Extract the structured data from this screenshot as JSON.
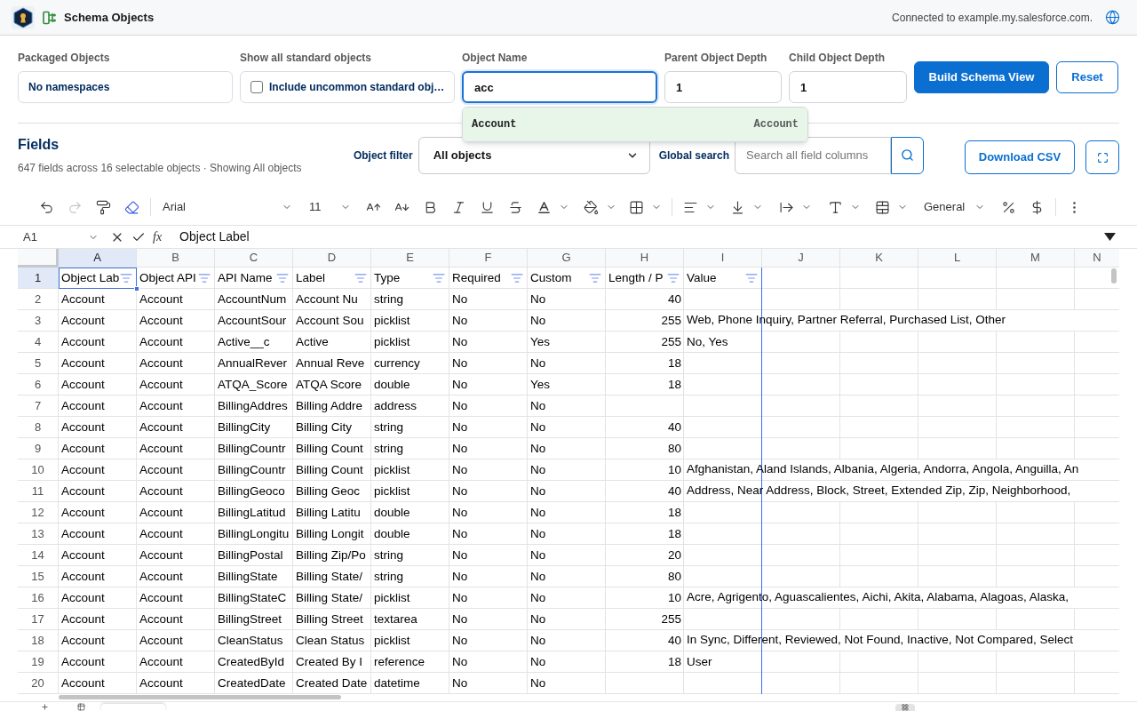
{
  "header": {
    "title": "Schema Objects",
    "connection": "Connected to example.my.salesforce.com."
  },
  "filters": {
    "packaged_objects": {
      "label": "Packaged Objects",
      "value": "No namespaces"
    },
    "standard_objects": {
      "label": "Show all standard objects",
      "option": "Include uncommon standard obj…",
      "checked": false
    },
    "object_name": {
      "label": "Object Name",
      "value": "acc",
      "focused": true,
      "suggestions": [
        {
          "label": "Account",
          "api_name": "Account",
          "selected": true
        }
      ]
    },
    "parent_depth": {
      "label": "Parent Object Depth",
      "value": "1"
    },
    "child_depth": {
      "label": "Child Object Depth",
      "value": "1"
    },
    "buttons": [
      {
        "label": "Build Schema View",
        "kind": "primary"
      },
      {
        "label": "Reset",
        "kind": "secondary"
      }
    ]
  },
  "fields": {
    "title": "Fields",
    "summary": "647 fields across 16 selectable objects · Showing All objects",
    "object_filter": {
      "label": "Object filter",
      "value": "All objects"
    },
    "global_search": {
      "label": "Global search",
      "placeholder": "Search all field columns"
    },
    "download_button": "Download CSV"
  },
  "toolbar": {
    "history": [
      {
        "kind": "undo",
        "disabled": false
      },
      {
        "kind": "redo",
        "disabled": true
      }
    ],
    "font": "Arial",
    "font_size": "11",
    "number_format": "General"
  },
  "formula_bar": {
    "cell_ref": "A1",
    "function_label": "fx",
    "value": "Object Label"
  },
  "sheet": {
    "columns": [
      {
        "label": "A",
        "selected": true
      },
      {
        "label": "B",
        "selected": false
      },
      {
        "label": "C",
        "selected": false
      },
      {
        "label": "D",
        "selected": false
      },
      {
        "label": "E",
        "selected": false
      },
      {
        "label": "F",
        "selected": false
      },
      {
        "label": "G",
        "selected": false
      },
      {
        "label": "H",
        "selected": false
      },
      {
        "label": "I",
        "selected": false
      },
      {
        "label": "J",
        "selected": false
      },
      {
        "label": "K",
        "selected": false
      },
      {
        "label": "L",
        "selected": false
      },
      {
        "label": "M",
        "selected": false
      },
      {
        "label": "N",
        "selected": false
      }
    ],
    "header_row": {
      "number": "1",
      "selected": true,
      "cells": [
        "Object Lab",
        "Object API",
        "API Name",
        "Label",
        "Type",
        "Required",
        "Custom",
        "Length / P",
        "Value"
      ]
    },
    "rows": [
      {
        "number": "2",
        "selected": false,
        "object_label": "Account",
        "object_api": "Account",
        "api_name": "AccountNum",
        "label": "Account Nu",
        "type": "string",
        "required": "No",
        "custom": "No",
        "length": "40"
      },
      {
        "number": "3",
        "selected": false,
        "object_label": "Account",
        "object_api": "Account",
        "api_name": "AccountSour",
        "label": "Account Sou",
        "type": "picklist",
        "required": "No",
        "custom": "No",
        "length": "255",
        "value": "Web, Phone Inquiry, Partner Referral, Purchased List, Other"
      },
      {
        "number": "4",
        "selected": false,
        "object_label": "Account",
        "object_api": "Account",
        "api_name": "Active__c",
        "label": "Active",
        "type": "picklist",
        "required": "No",
        "custom": "Yes",
        "length": "255",
        "value": "No, Yes"
      },
      {
        "number": "5",
        "selected": false,
        "object_label": "Account",
        "object_api": "Account",
        "api_name": "AnnualRever",
        "label": "Annual Reve",
        "type": "currency",
        "required": "No",
        "custom": "No",
        "length": "18"
      },
      {
        "number": "6",
        "selected": false,
        "object_label": "Account",
        "object_api": "Account",
        "api_name": "ATQA_Score",
        "label": "ATQA Score",
        "type": "double",
        "required": "No",
        "custom": "Yes",
        "length": "18"
      },
      {
        "number": "7",
        "selected": false,
        "object_label": "Account",
        "object_api": "Account",
        "api_name": "BillingAddres",
        "label": "Billing Addre",
        "type": "address",
        "required": "No",
        "custom": "No"
      },
      {
        "number": "8",
        "selected": false,
        "object_label": "Account",
        "object_api": "Account",
        "api_name": "BillingCity",
        "label": "Billing City",
        "type": "string",
        "required": "No",
        "custom": "No",
        "length": "40"
      },
      {
        "number": "9",
        "selected": false,
        "object_label": "Account",
        "object_api": "Account",
        "api_name": "BillingCountr",
        "label": "Billing Count",
        "type": "string",
        "required": "No",
        "custom": "No",
        "length": "80"
      },
      {
        "number": "10",
        "selected": false,
        "object_label": "Account",
        "object_api": "Account",
        "api_name": "BillingCountr",
        "label": "Billing Count",
        "type": "picklist",
        "required": "No",
        "custom": "No",
        "length": "10",
        "value": "Afghanistan, Aland Islands, Albania, Algeria, Andorra, Angola, Anguilla, An"
      },
      {
        "number": "11",
        "selected": false,
        "object_label": "Account",
        "object_api": "Account",
        "api_name": "BillingGeoco",
        "label": "Billing Geoc",
        "type": "picklist",
        "required": "No",
        "custom": "No",
        "length": "40",
        "value": "Address, Near Address, Block, Street, Extended Zip, Zip, Neighborhood,"
      },
      {
        "number": "12",
        "selected": false,
        "object_label": "Account",
        "object_api": "Account",
        "api_name": "BillingLatitud",
        "label": "Billing Latitu",
        "type": "double",
        "required": "No",
        "custom": "No",
        "length": "18"
      },
      {
        "number": "13",
        "selected": false,
        "object_label": "Account",
        "object_api": "Account",
        "api_name": "BillingLongitu",
        "label": "Billing Longit",
        "type": "double",
        "required": "No",
        "custom": "No",
        "length": "18"
      },
      {
        "number": "14",
        "selected": false,
        "object_label": "Account",
        "object_api": "Account",
        "api_name": "BillingPostal",
        "label": "Billing Zip/Po",
        "type": "string",
        "required": "No",
        "custom": "No",
        "length": "20"
      },
      {
        "number": "15",
        "selected": false,
        "object_label": "Account",
        "object_api": "Account",
        "api_name": "BillingState",
        "label": "Billing State/",
        "type": "string",
        "required": "No",
        "custom": "No",
        "length": "80"
      },
      {
        "number": "16",
        "selected": false,
        "object_label": "Account",
        "object_api": "Account",
        "api_name": "BillingStateC",
        "label": "Billing State/",
        "type": "picklist",
        "required": "No",
        "custom": "No",
        "length": "10",
        "value": "Acre, Agrigento, Aguascalientes, Aichi, Akita, Alabama, Alagoas, Alaska,"
      },
      {
        "number": "17",
        "selected": false,
        "object_label": "Account",
        "object_api": "Account",
        "api_name": "BillingStreet",
        "label": "Billing Street",
        "type": "textarea",
        "required": "No",
        "custom": "No",
        "length": "255"
      },
      {
        "number": "18",
        "selected": false,
        "object_label": "Account",
        "object_api": "Account",
        "api_name": "CleanStatus",
        "label": "Clean Status",
        "type": "picklist",
        "required": "No",
        "custom": "No",
        "length": "40",
        "value": "In Sync, Different, Reviewed, Not Found, Inactive, Not Compared, Select"
      },
      {
        "number": "19",
        "selected": false,
        "object_label": "Account",
        "object_api": "Account",
        "api_name": "CreatedById",
        "label": "Created By I",
        "type": "reference",
        "required": "No",
        "custom": "No",
        "length": "18",
        "value": "User"
      },
      {
        "number": "20",
        "selected": false,
        "object_label": "Account",
        "object_api": "Account",
        "api_name": "CreatedDate",
        "label": "Created Date",
        "type": "datetime",
        "required": "No",
        "custom": "No"
      }
    ]
  }
}
